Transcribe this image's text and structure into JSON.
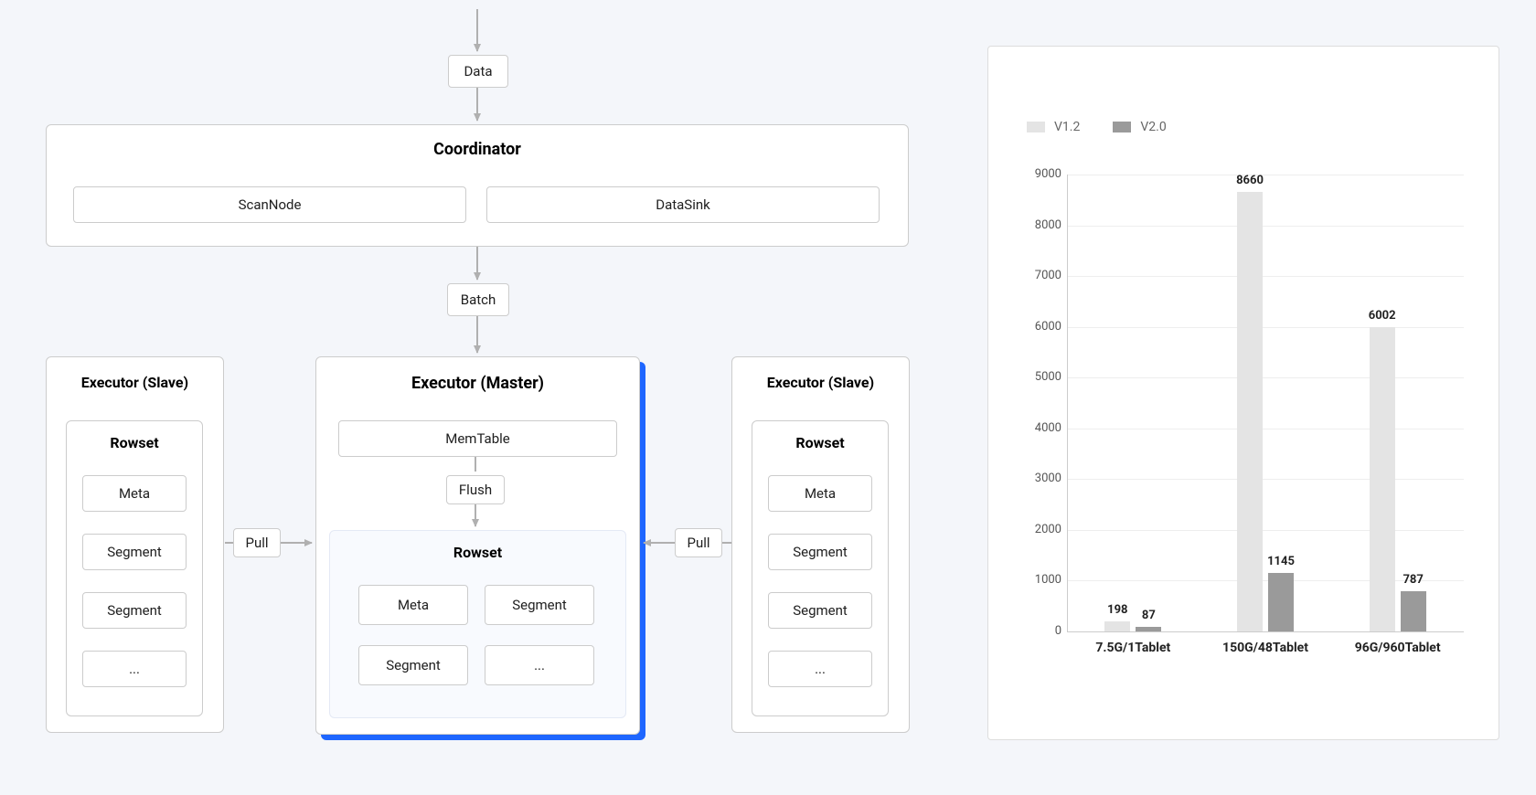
{
  "diagram": {
    "data": "Data",
    "coordinator": {
      "title": "Coordinator",
      "scan": "ScanNode",
      "sink": "DataSink"
    },
    "batch": "Batch",
    "slave_title": "Executor (Slave)",
    "master_title": "Executor (Master)",
    "memtable": "MemTable",
    "flush": "Flush",
    "rowset": "Rowset",
    "meta": "Meta",
    "segment": "Segment",
    "more": "...",
    "pull": "Pull"
  },
  "chart_data": {
    "type": "bar",
    "categories": [
      "7.5G/1Tablet",
      "150G/48Tablet",
      "96G/960Tablet"
    ],
    "series": [
      {
        "name": "V1.2",
        "color": "#e4e4e4",
        "values": [
          198,
          8660,
          6002
        ]
      },
      {
        "name": "V2.0",
        "color": "#9a9a9a",
        "values": [
          87,
          1145,
          787
        ]
      }
    ],
    "ylim": [
      0,
      9000
    ],
    "ytick_step": 1000,
    "title": "",
    "xlabel": "",
    "ylabel": ""
  }
}
